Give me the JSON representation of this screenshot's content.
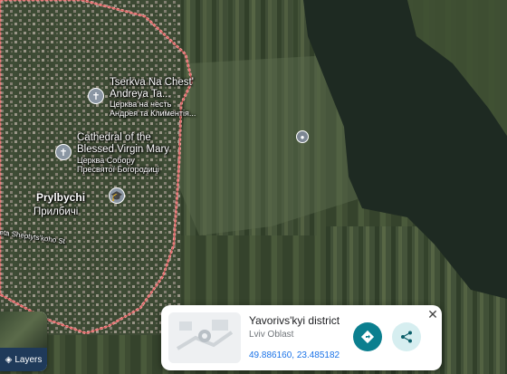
{
  "map": {
    "view": "satellite",
    "colors": {
      "boundary": "#f0a0a0",
      "water": "#1f2a23",
      "field_dark": "#2e3a27"
    }
  },
  "pois": [
    {
      "name": "Tserkva Na Chest' Andreya Ta...",
      "line1": "Tserkva Na Chest'",
      "line2": "Andreya Ta...",
      "sub1": "Церква на честь",
      "sub2": "Андрея та Климентія...",
      "icon": "church-icon"
    },
    {
      "name": "Cathedral of the Blessed Virgin Mary",
      "line1": "Cathedral of the",
      "line2": "Blessed Virgin Mary",
      "sub1": "Церква Собору",
      "sub2": "Пресвятої Богородиці",
      "icon": "church-icon"
    }
  ],
  "town": {
    "name": "Prylbychi",
    "name_local": "Прилбичі"
  },
  "street": {
    "name": "eta Sheptyts'koho St"
  },
  "layers": {
    "label": "Layers"
  },
  "card": {
    "title": "Yavorivs'kyi district",
    "subtitle": "Lviv Oblast",
    "coords": "49.886160, 23.485182",
    "close_glyph": "✕"
  }
}
